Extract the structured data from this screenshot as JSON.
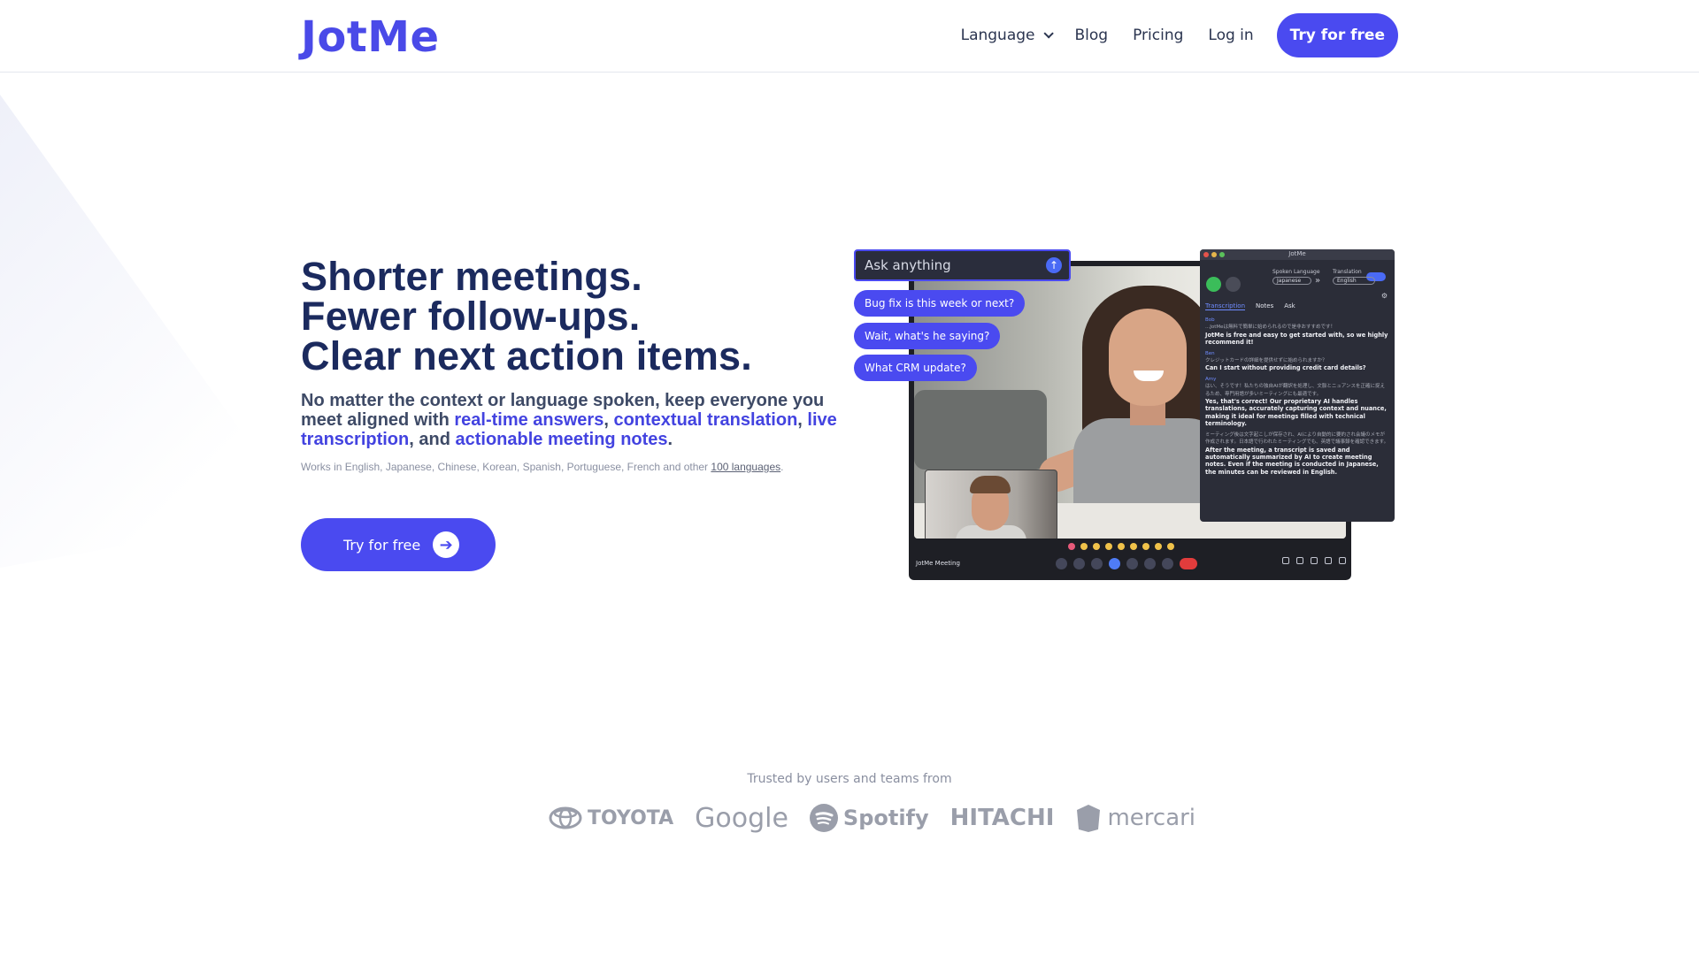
{
  "header": {
    "logo": "JotMe",
    "nav": {
      "language": "Language",
      "blog": "Blog",
      "pricing": "Pricing",
      "login": "Log in",
      "cta": "Try for free"
    }
  },
  "hero": {
    "title_lines": [
      "Shorter meetings.",
      "Fewer follow-ups.",
      "Clear next action items."
    ],
    "subtitle": {
      "part1": "No matter the context or language spoken, keep everyone you meet aligned with ",
      "hl1": "real-time answers",
      "sep1": ", ",
      "hl2": "contextual translation",
      "sep2": ", ",
      "hl3": "live transcription",
      "sep3": ", and ",
      "hl4": "actionable meeting notes",
      "end": "."
    },
    "works_prefix": "Works in English, Japanese, Chinese, Korean, Spanish, Portuguese, French and other ",
    "works_link": "100 languages",
    "works_suffix": ".",
    "cta": "Try for free",
    "cta_icon": "arrow-right-icon"
  },
  "mockup": {
    "ask_placeholder": "Ask anything",
    "chips": [
      "Bug fix is this week or next?",
      "Wait, what's he saying?",
      "What CRM update?"
    ],
    "meeting_title": "JotMe Meeting",
    "panel": {
      "app_name": "JotMe",
      "spoken_language_label": "Spoken Language",
      "spoken_language": "Japanese",
      "translation_label": "Translation",
      "translation_language": "English",
      "tabs": [
        "Transcription",
        "Notes",
        "Ask"
      ],
      "transcript": [
        {
          "speaker": "Bob",
          "jp": "...JotMeは無料で簡単に始められるので是非おすすめです！",
          "en": "JotMe is free and easy to get started with, so we highly recommend it!"
        },
        {
          "speaker": "Ben",
          "jp": "クレジットカードの詳細を提供せずに始められますか？",
          "en": "Can I start without providing credit card details?"
        },
        {
          "speaker": "Amy",
          "jp": "はい、そうです！私たちの独自AIが翻訳を処理し、文脈とニュアンスを正確に捉えるため、専門用語が多いミーティングにも最適です。",
          "en": "Yes, that's correct! Our proprietary AI handles translations, accurately capturing context and nuance, making it ideal for meetings filled with technical terminology."
        },
        {
          "speaker": "",
          "jp": "ミーティング後は文字起こしが保存され、AIにより自動的に要約され会議のメモが作成されます。日本語で行われたミーティングでも、英語で議事録を確認できます。",
          "en": "After the meeting, a transcript is saved and automatically summarized by AI to create meeting notes. Even if the meeting is conducted in Japanese, the minutes can be reviewed in English."
        }
      ]
    }
  },
  "trusted": {
    "label": "Trusted by users and teams from",
    "brands": [
      "TOYOTA",
      "Google",
      "Spotify",
      "HITACHI",
      "mercari"
    ]
  },
  "colors": {
    "brand": "#4a4af0",
    "title": "#1b2a5e",
    "highlight": "#4343e0"
  }
}
